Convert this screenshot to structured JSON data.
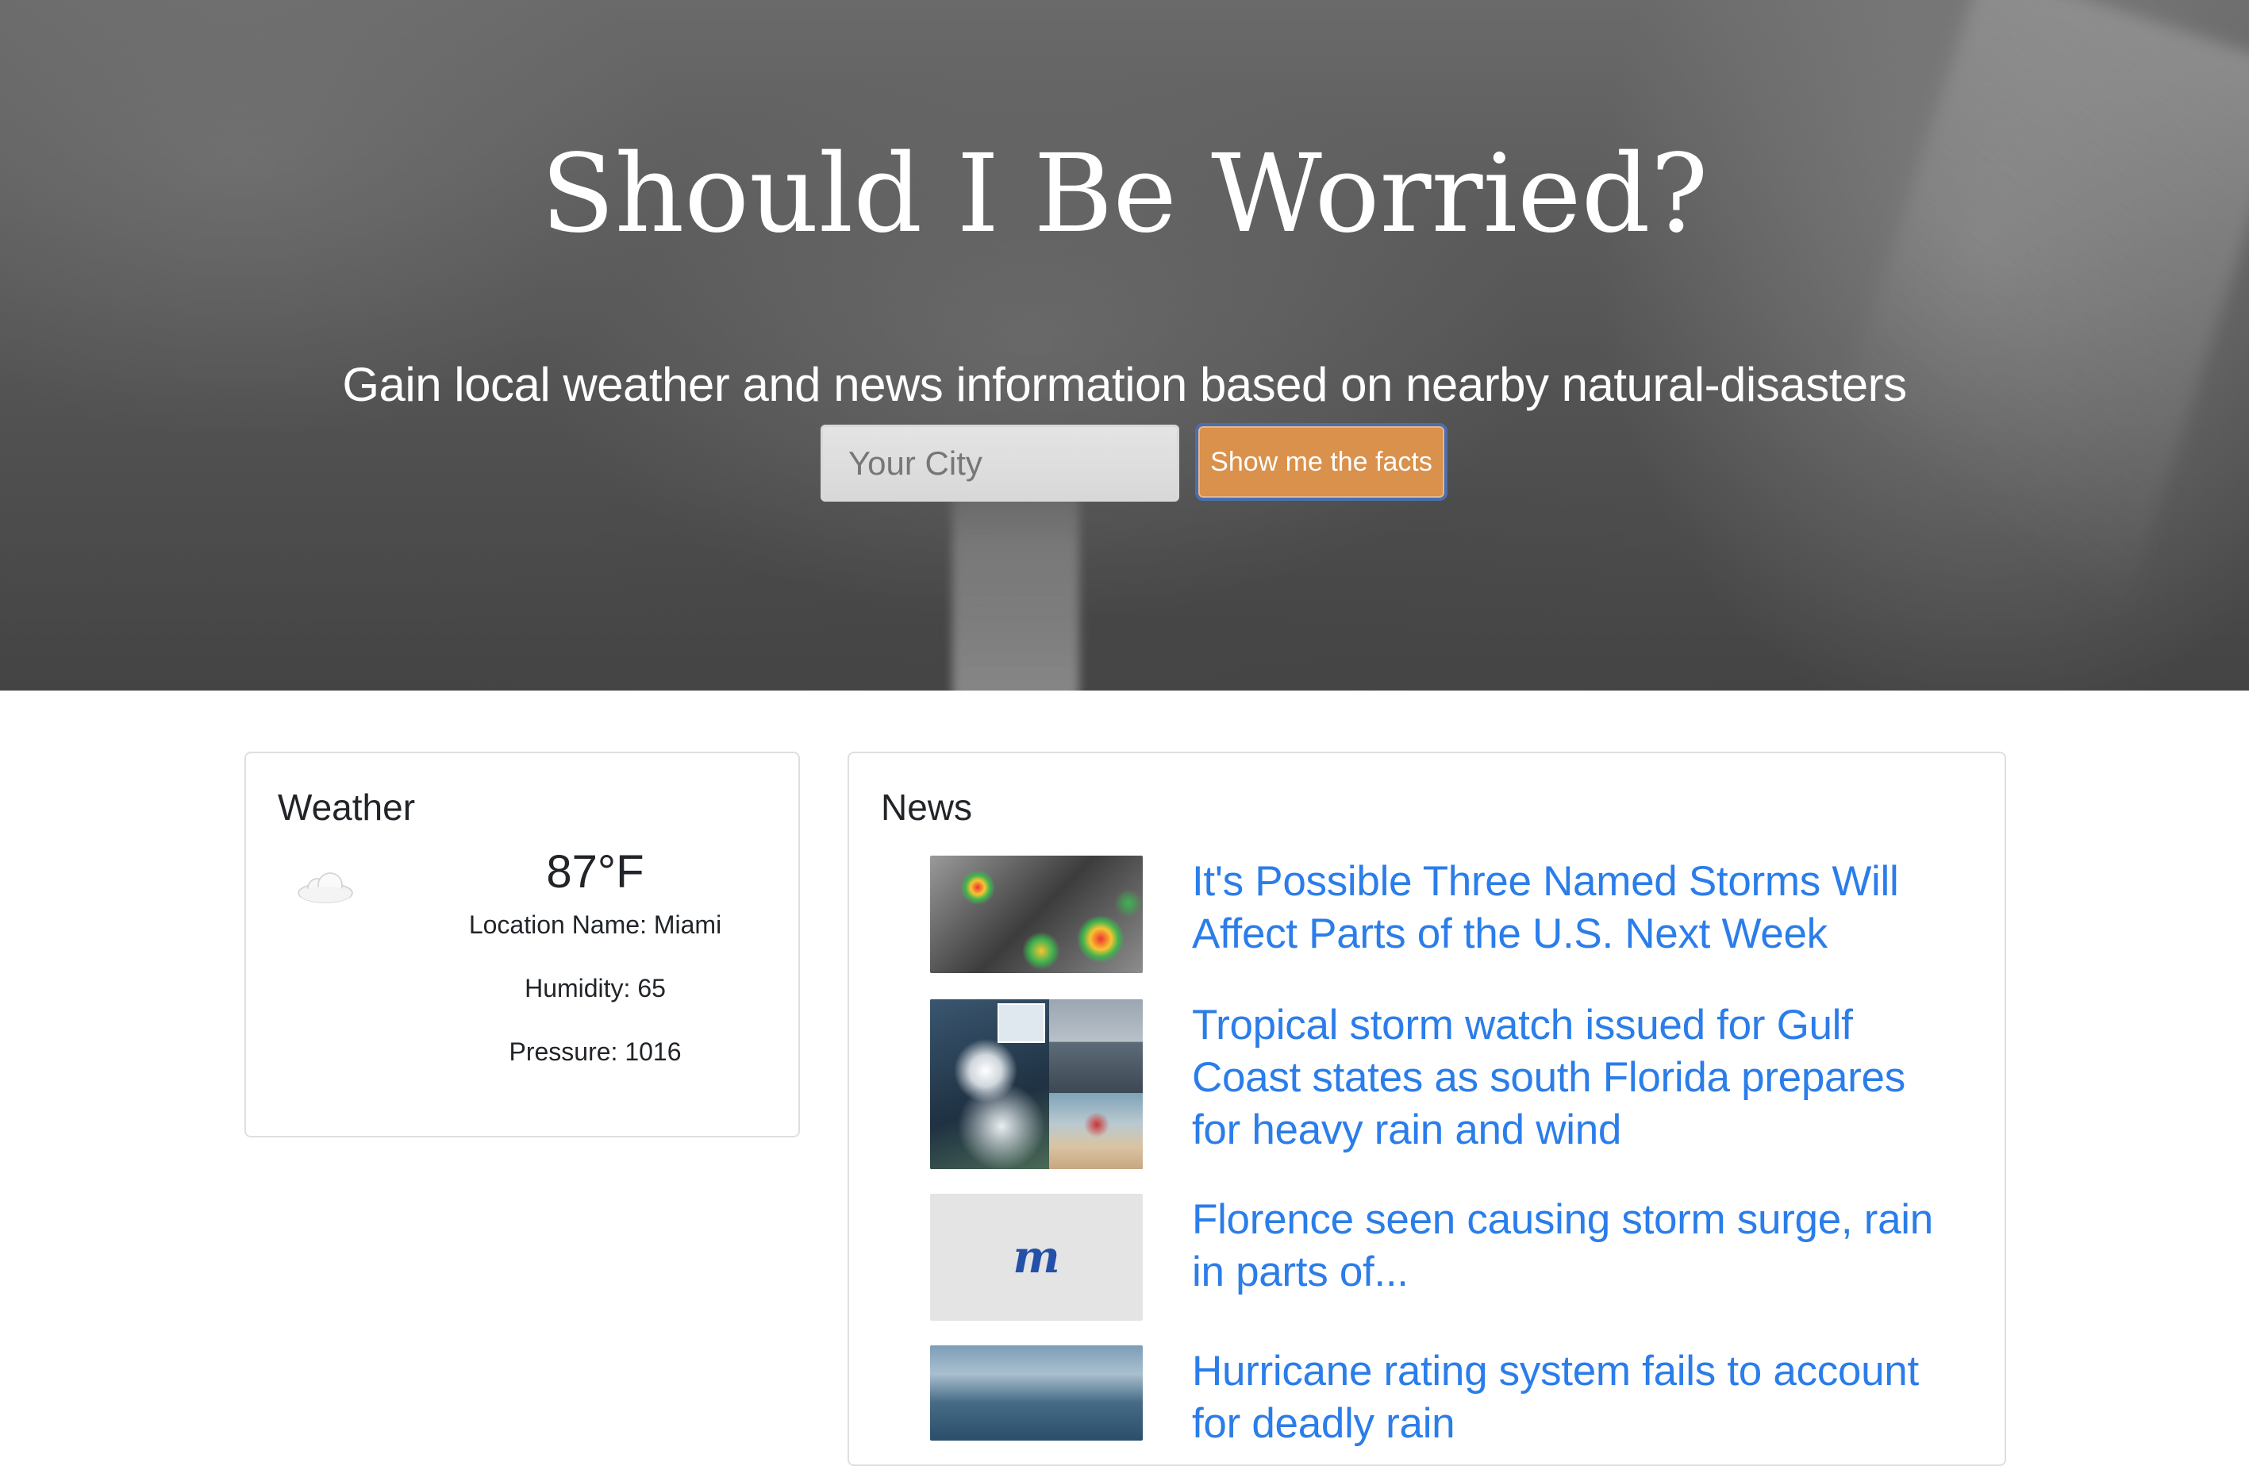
{
  "hero": {
    "title": "Should I Be Worried?",
    "subtitle": "Gain local weather and news information based on nearby natural-disasters",
    "search_placeholder": "Your City",
    "button_label": "Show me the facts"
  },
  "weather": {
    "heading": "Weather",
    "icon": "cloud-icon",
    "temperature": "87°F",
    "location": "Location Name: Miami",
    "humidity": "Humidity: 65",
    "pressure": "Pressure: 1016"
  },
  "news": {
    "heading": "News",
    "items": [
      {
        "title": "It's Possible Three Named Storms Will Affect Parts of the U.S. Next Week",
        "thumb": "satellite-radar-image"
      },
      {
        "title": "Tropical storm watch issued for Gulf Coast states as south Florida prepares for heavy rain and wind",
        "thumb": "storm-collage-image"
      },
      {
        "title": "Florence seen causing storm surge, rain in parts of...",
        "thumb": "publisher-logo-image"
      },
      {
        "title": "Hurricane rating system fails to account for deadly rain",
        "thumb": "flooded-highway-image"
      }
    ]
  },
  "colors": {
    "button_bg": "#d9914c",
    "link": "#2b7de9",
    "hero_overlay": "#555555"
  }
}
